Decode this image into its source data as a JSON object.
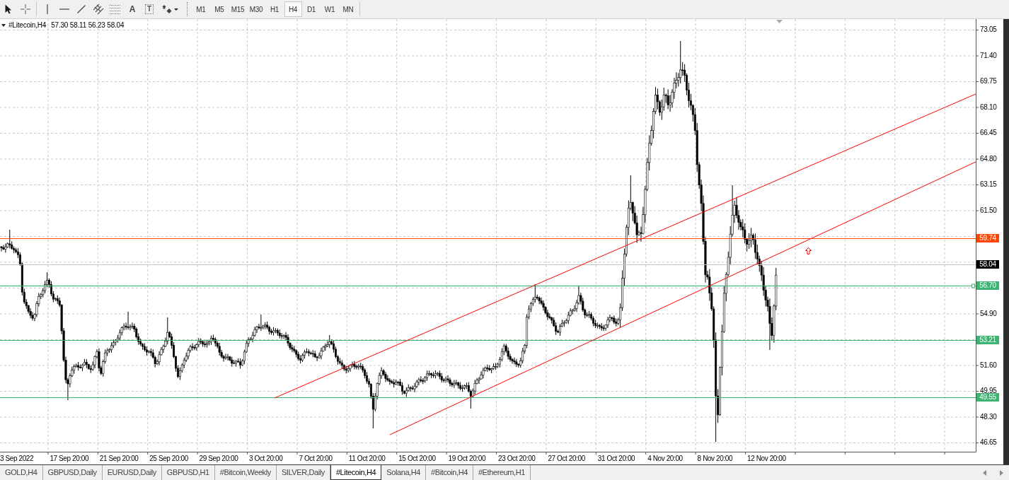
{
  "toolbar": {
    "pointer_tools": [
      {
        "kind": "cursor"
      },
      {
        "kind": "crosshair"
      }
    ],
    "object_tools": [
      {
        "kind": "vertical-line"
      },
      {
        "kind": "horizontal-line"
      },
      {
        "kind": "trendline"
      },
      {
        "kind": "channel"
      },
      {
        "kind": "fibonacci"
      },
      {
        "kind": "text",
        "glyph": "A"
      },
      {
        "kind": "label",
        "glyph": "T"
      },
      {
        "kind": "arrows"
      }
    ],
    "timeframes": [
      {
        "label": "M1",
        "selected": false
      },
      {
        "label": "M5",
        "selected": false
      },
      {
        "label": "M15",
        "selected": false
      },
      {
        "label": "M30",
        "selected": false
      },
      {
        "label": "H1",
        "selected": false
      },
      {
        "label": "H4",
        "selected": true
      },
      {
        "label": "D1",
        "selected": false
      },
      {
        "label": "W1",
        "selected": false
      },
      {
        "label": "MN",
        "selected": false
      }
    ]
  },
  "chart": {
    "symbol": "#Litecoin,H4",
    "ohlc": "57.30 58.11 56.23 58.04",
    "price_axis": [
      "73.05",
      "71.40",
      "69.75",
      "68.10",
      "66.45",
      "64.80",
      "63.15",
      "61.50",
      "54.90",
      "51.60",
      "49.95",
      "48.30",
      "46.65"
    ],
    "levels": [
      {
        "kind": "line",
        "label": "59.74",
        "color": "#ff4500",
        "selected": false
      },
      {
        "kind": "bid",
        "label": "58.04",
        "color": "#000000",
        "selected": false
      },
      {
        "kind": "line",
        "label": "56.70",
        "color": "#3cb371",
        "selected": true
      },
      {
        "kind": "line",
        "label": "53.21",
        "color": "#3cb371",
        "selected": false
      },
      {
        "kind": "line",
        "label": "49.55",
        "color": "#3cb371",
        "selected": false
      }
    ],
    "time_axis": [
      "3 Sep 2022",
      "17 Sep 20:00",
      "21 Sep 20:00",
      "25 Sep 20:00",
      "29 Sep 20:00",
      "3 Oct 20:00",
      "7 Oct 20:00",
      "11 Oct 20:00",
      "15 Oct 20:00",
      "19 Oct 20:00",
      "23 Oct 20:00",
      "27 Oct 20:00",
      "31 Oct 20:00",
      "4 Nov 20:00",
      "8 Nov 20:00",
      "12 Nov 20:00"
    ]
  },
  "tabs": [
    {
      "label": "GOLD,H4",
      "selected": false
    },
    {
      "label": "GBPUSD,Daily",
      "selected": false
    },
    {
      "label": "EURUSD,Daily",
      "selected": false
    },
    {
      "label": "GBPUSD,H1",
      "selected": false
    },
    {
      "label": "#Bitcoin,Weekly",
      "selected": false
    },
    {
      "label": "SILVER,Daily",
      "selected": false
    },
    {
      "label": "#Litecoin,H4",
      "selected": true
    },
    {
      "label": "Solana,H4",
      "selected": false
    },
    {
      "label": "#Bitcoin,H4",
      "selected": false
    },
    {
      "label": "#Ethereum,H1",
      "selected": false
    }
  ]
}
